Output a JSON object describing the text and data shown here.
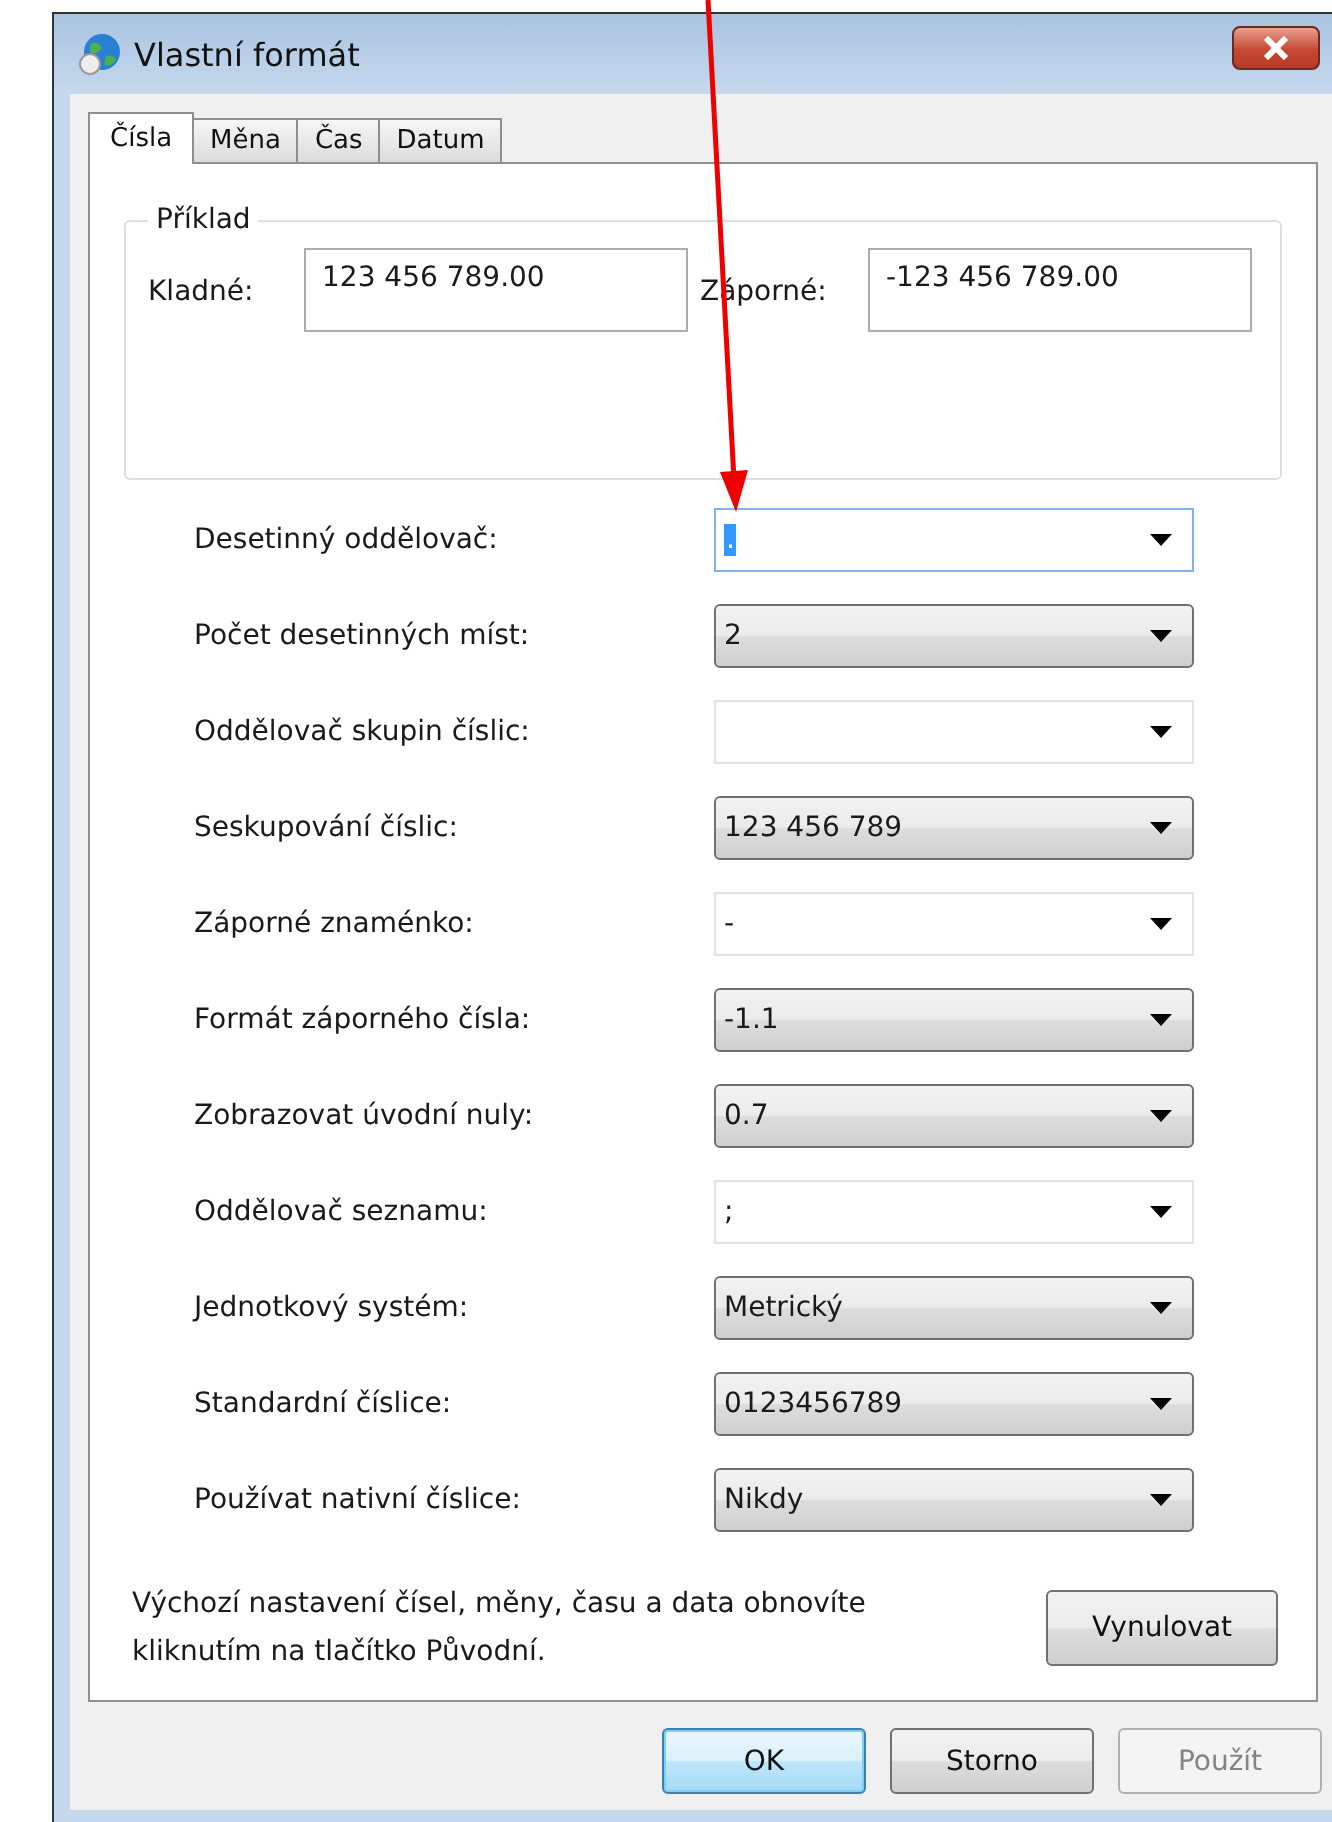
{
  "window": {
    "title": "Vlastní formát"
  },
  "tabs": [
    {
      "label": "Čísla",
      "selected": true
    },
    {
      "label": "Měna",
      "selected": false
    },
    {
      "label": "Čas",
      "selected": false
    },
    {
      "label": "Datum",
      "selected": false
    }
  ],
  "example": {
    "title": "Příklad",
    "positive_label": "Kladné:",
    "positive_value": "123 456 789.00",
    "negative_label": "Záporné:",
    "negative_value": "-123 456 789.00"
  },
  "settings": [
    {
      "label": "Desetinný oddělovač:",
      "value": ".",
      "kind": "editable",
      "focused": true
    },
    {
      "label": "Počet desetinných míst:",
      "value": "2",
      "kind": "list",
      "focused": false
    },
    {
      "label": "Oddělovač skupin číslic:",
      "kind": "editable",
      "focused": false
    },
    {
      "label": "Seskupování číslic:",
      "value": "123 456 789",
      "kind": "list",
      "focused": false
    },
    {
      "label": "Záporné znaménko:",
      "value": "-",
      "kind": "editable",
      "focused": false
    },
    {
      "label": "Formát záporného čísla:",
      "value": "-1.1",
      "kind": "list",
      "focused": false
    },
    {
      "label": "Zobrazovat úvodní nuly:",
      "value": "0.7",
      "kind": "list",
      "focused": false
    },
    {
      "label": "Oddělovač seznamu:",
      "value": ";",
      "kind": "editable",
      "focused": false
    },
    {
      "label": "Jednotkový systém:",
      "value": "Metrický",
      "kind": "list",
      "focused": false
    },
    {
      "label": "Standardní číslice:",
      "value": "0123456789",
      "kind": "list",
      "focused": false
    },
    {
      "label": "Používat nativní číslice:",
      "value": "Nikdy",
      "kind": "list",
      "focused": false
    }
  ],
  "footer": {
    "text": "Výchozí nastavení čísel, měny, času a data obnovíte kliknutím na tlačítko Původní.",
    "reset_button": "Vynulovat"
  },
  "buttons": [
    {
      "label": "OK",
      "default": true,
      "disabled": false
    },
    {
      "label": "Storno",
      "default": false,
      "disabled": false
    },
    {
      "label": "Použít",
      "default": false,
      "disabled": true
    }
  ]
}
